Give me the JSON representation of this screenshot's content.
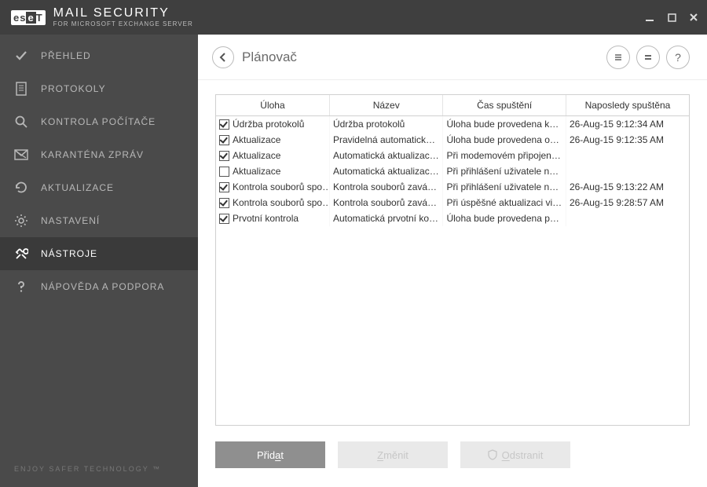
{
  "titlebar": {
    "product_main": "MAIL SECURITY",
    "product_sub": "FOR MICROSOFT EXCHANGE SERVER",
    "logo_text": "eseT"
  },
  "sidebar": {
    "items": [
      {
        "key": "overview",
        "label": "PŘEHLED"
      },
      {
        "key": "logs",
        "label": "PROTOKOLY"
      },
      {
        "key": "scan",
        "label": "KONTROLA POČÍTAČE"
      },
      {
        "key": "quarantine",
        "label": "KARANTÉNA ZPRÁV"
      },
      {
        "key": "update",
        "label": "AKTUALIZACE"
      },
      {
        "key": "setup",
        "label": "NASTAVENÍ"
      },
      {
        "key": "tools",
        "label": "NÁSTROJE"
      },
      {
        "key": "help",
        "label": "NÁPOVĚDA A PODPORA"
      }
    ],
    "active": "tools",
    "footer": "ENJOY SAFER TECHNOLOGY ™"
  },
  "header": {
    "title": "Plánovač",
    "help_label": "?"
  },
  "table": {
    "columns": {
      "task": "Úloha",
      "name": "Název",
      "launch": "Čas spuštění",
      "last": "Naposledy spuštěna"
    },
    "rows": [
      {
        "checked": true,
        "task": "Údržba protokolů",
        "name": "Údržba protokolů",
        "launch": "Úloha bude provedena ka…",
        "last": "26-Aug-15 9:12:34 AM"
      },
      {
        "checked": true,
        "task": "Aktualizace",
        "name": "Pravidelná automatická a…",
        "launch": "Úloha bude provedena op…",
        "last": "26-Aug-15 9:12:35 AM"
      },
      {
        "checked": true,
        "task": "Aktualizace",
        "name": "Automatická aktualizace …",
        "launch": "Při modemovém připojen…",
        "last": ""
      },
      {
        "checked": false,
        "task": "Aktualizace",
        "name": "Automatická aktualizace …",
        "launch": "Při přihlášení uživatele na …",
        "last": ""
      },
      {
        "checked": true,
        "task": "Kontrola souborů spo…",
        "name": "Kontrola souborů zavádě…",
        "launch": "Při přihlášení uživatele na …",
        "last": "26-Aug-15 9:13:22 AM"
      },
      {
        "checked": true,
        "task": "Kontrola souborů spo…",
        "name": "Kontrola souborů zavádě…",
        "launch": "Při úspěšné aktualizaci vir…",
        "last": "26-Aug-15 9:28:57 AM"
      },
      {
        "checked": true,
        "task": "Prvotní kontrola",
        "name": "Automatická prvotní kont…",
        "launch": "Úloha bude provedena po…",
        "last": ""
      }
    ]
  },
  "actions": {
    "add": "Přidat",
    "edit": "Změnit",
    "delete": "Odstranit"
  }
}
